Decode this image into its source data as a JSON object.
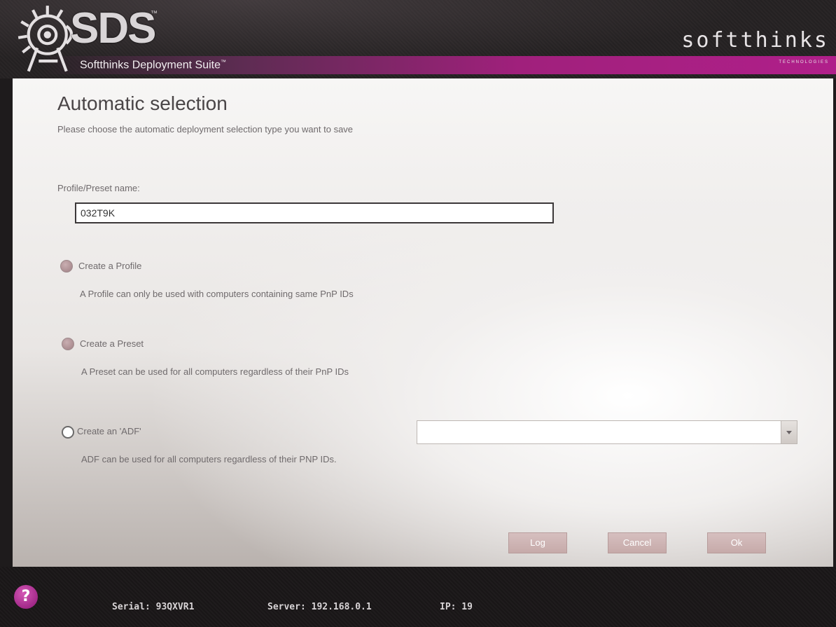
{
  "header": {
    "logo_text": "SDS",
    "trademark": "™",
    "suite_name": "Softthinks Deployment Suite",
    "suite_tm": "™",
    "brand_name": "softthinks",
    "brand_sub": "TECHNOLOGIES"
  },
  "page": {
    "title": "Automatic selection",
    "subtitle": "Please choose the automatic deployment selection type you want to save"
  },
  "profile_name": {
    "label": "Profile/Preset name:",
    "value": "032T9K"
  },
  "options": [
    {
      "label": "Create a Profile",
      "description": "A Profile can only be used with computers containing same PnP IDs",
      "state": "disabled"
    },
    {
      "label": "Create a Preset",
      "description": "A Preset can be used for all computers regardless of their PnP IDs",
      "state": "disabled"
    },
    {
      "label": "Create an 'ADF'",
      "description": "ADF can be used for all computers regardless of their PNP IDs.",
      "state": "unselected"
    }
  ],
  "adf_select": {
    "value": ""
  },
  "buttons": {
    "log": "Log",
    "cancel": "Cancel",
    "ok": "Ok"
  },
  "footer": {
    "help": "?",
    "serial": "Serial: 93QXVR1",
    "server": "Server: 192.168.0.1",
    "ip": "IP: 19"
  },
  "colors": {
    "accent": "#a0207c",
    "button": "#c9afae",
    "help": "#b0349a"
  },
  "icons": {
    "emblem": "sds-robot-emblem-icon",
    "help": "help-icon",
    "dropdown": "chevron-down-icon"
  }
}
